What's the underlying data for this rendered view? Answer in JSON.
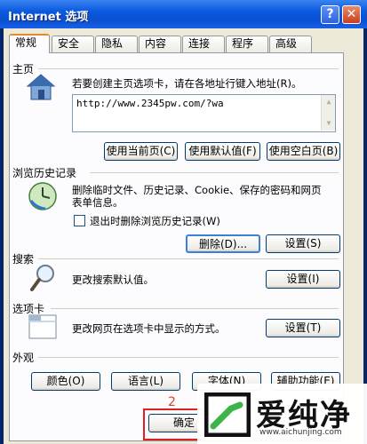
{
  "window": {
    "title": "Internet 选项",
    "help_label": "?",
    "close_label": "✕"
  },
  "tabs": [
    "常规",
    "安全",
    "隐私",
    "内容",
    "连接",
    "程序",
    "高级"
  ],
  "home": {
    "group_label": "主页",
    "desc": "若要创建主页选项卡，请在各地址行键入地址(R)。",
    "url": "http://www.2345pw.com/?wa",
    "buttons": [
      "使用当前页(C)",
      "使用默认值(F)",
      "使用空白页(B)"
    ]
  },
  "history": {
    "group_label": "浏览历史记录",
    "desc_line1": "删除临时文件、历史记录、Cookie、保存的密码和网页",
    "desc_line2": "表单信息。",
    "checkbox_label": "退出时删除浏览历史记录(W)",
    "delete_label": "删除(D)...",
    "settings_label": "设置(S)"
  },
  "search": {
    "group_label": "搜索",
    "desc": "更改搜索默认值。",
    "settings_label": "设置(I)"
  },
  "tabsgroup": {
    "group_label": "选项卡",
    "desc": "更改网页在选项卡中显示的方式。",
    "settings_label": "设置(T)"
  },
  "appearance": {
    "group_label": "外观",
    "buttons": [
      "颜色(O)",
      "语言(L)",
      "字体(N)",
      "辅助功能(E)"
    ]
  },
  "footer": {
    "ok_label": "确定"
  },
  "annotation": {
    "step_number": "2"
  },
  "watermark": {
    "brand": "爱纯净",
    "url": "www.aichunjing.com"
  },
  "colors": {
    "titlebar": "#0a5ae0",
    "annotation_red": "#e02020",
    "client_bg": "#ece9d8"
  },
  "icons": {
    "help": "question-mark",
    "close": "x",
    "home": "house-icon",
    "history": "clock-globe-icon",
    "search": "magnifier-icon",
    "tabs": "tab-window-icon"
  }
}
